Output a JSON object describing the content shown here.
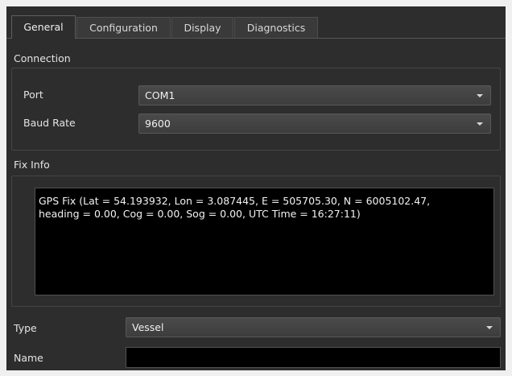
{
  "tabs": [
    {
      "label": "General",
      "active": true
    },
    {
      "label": "Configuration",
      "active": false
    },
    {
      "label": "Display",
      "active": false
    },
    {
      "label": "Diagnostics",
      "active": false
    }
  ],
  "connection": {
    "title": "Connection",
    "port_label": "Port",
    "port_value": "COM1",
    "baud_label": "Baud Rate",
    "baud_value": "9600"
  },
  "fix_info": {
    "title": "Fix Info",
    "text": "GPS Fix (Lat = 54.193932, Lon = 3.087445, E = 505705.30, N = 6005102.47,\nheading = 0.00, Cog = 0.00, Sog = 0.00, UTC Time = 16:27:11)"
  },
  "type": {
    "label": "Type",
    "value": "Vessel"
  },
  "name": {
    "label": "Name",
    "value": ""
  },
  "colors": {
    "panel": "#2d2d2d",
    "text": "#e4e4e4",
    "console_bg": "#000000"
  }
}
